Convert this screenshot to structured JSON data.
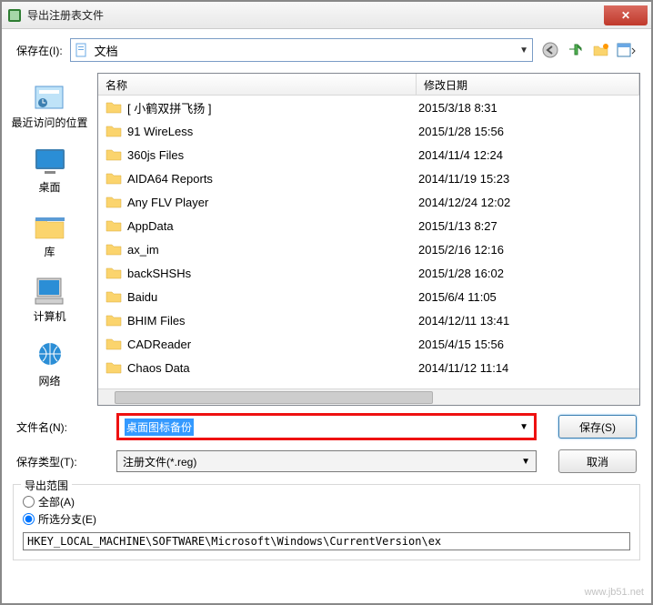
{
  "window": {
    "title": "导出注册表文件",
    "close_glyph": "✕"
  },
  "toolbar": {
    "save_in_label": "保存在(I):",
    "location": "文档"
  },
  "sidebar": {
    "items": [
      {
        "label": "最近访问的位置"
      },
      {
        "label": "桌面"
      },
      {
        "label": "库"
      },
      {
        "label": "计算机"
      },
      {
        "label": "网络"
      }
    ]
  },
  "columns": {
    "name": "名称",
    "date": "修改日期"
  },
  "files": [
    {
      "name": "[ 小鹤双拼飞扬 ]",
      "date": "2015/3/18 8:31"
    },
    {
      "name": "91 WireLess",
      "date": "2015/1/28 15:56"
    },
    {
      "name": "360js Files",
      "date": "2014/11/4 12:24"
    },
    {
      "name": "AIDA64 Reports",
      "date": "2014/11/19 15:23"
    },
    {
      "name": "Any FLV Player",
      "date": "2014/12/24 12:02"
    },
    {
      "name": "AppData",
      "date": "2015/1/13 8:27"
    },
    {
      "name": "ax_im",
      "date": "2015/2/16 12:16"
    },
    {
      "name": "backSHSHs",
      "date": "2015/1/28 16:02"
    },
    {
      "name": "Baidu",
      "date": "2015/6/4 11:05"
    },
    {
      "name": "BHIM Files",
      "date": "2014/12/11 13:41"
    },
    {
      "name": "CADReader",
      "date": "2015/4/15 15:56"
    },
    {
      "name": "Chaos Data",
      "date": "2014/11/12 11:14"
    }
  ],
  "fields": {
    "filename_label": "文件名(N):",
    "filename_value": "桌面图标备份",
    "type_label": "保存类型(T):",
    "type_value": "注册文件(*.reg)",
    "save_btn": "保存(S)",
    "cancel_btn": "取消"
  },
  "export_range": {
    "legend": "导出范围",
    "all": "全部(A)",
    "selected": "所选分支(E)",
    "path": "HKEY_LOCAL_MACHINE\\SOFTWARE\\Microsoft\\Windows\\CurrentVersion\\ex"
  },
  "watermark": "www.jb51.net"
}
